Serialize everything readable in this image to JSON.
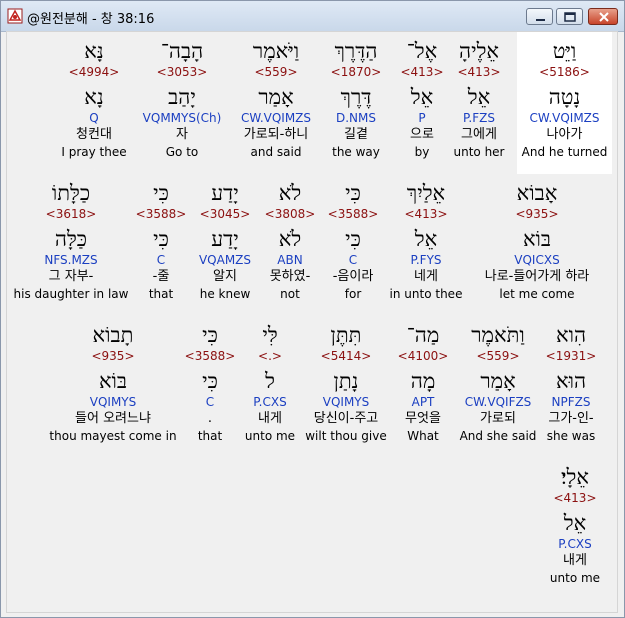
{
  "window": {
    "title": "@원전분해 - 창 38:16"
  },
  "words": [
    {
      "heb": "וַיֵּט",
      "num": "<5186>",
      "lex": "נָטָה",
      "parse": "CW.VQIMZS",
      "kor": "나아가",
      "eng": "And he turned",
      "selected": true
    },
    {
      "heb": "אֵלֶיהָ",
      "num": "<413>",
      "lex": "אֵל",
      "parse": "P.FZS",
      "kor": "그에게",
      "eng": "unto her"
    },
    {
      "heb": "אֶל־",
      "num": "<413>",
      "lex": "אֵל",
      "parse": "P",
      "kor": "으로",
      "eng": "by"
    },
    {
      "heb": "הַדֶּרֶךְ",
      "num": "<1870>",
      "lex": "דֶּרֶךְ",
      "parse": "D.NMS",
      "kor": "길곁",
      "eng": "the way"
    },
    {
      "heb": "וַיֹּאמֶר",
      "num": "<559>",
      "lex": "אָמַר",
      "parse": "CW.VQIMZS",
      "kor": "가로되-하니",
      "eng": "and said"
    },
    {
      "heb": "הָבָה־",
      "num": "<3053>",
      "lex": "יָהַב",
      "parse": "VQMMYS(Ch)",
      "kor": "자",
      "eng": "Go to"
    },
    {
      "heb": "נָּא",
      "num": "<4994>",
      "lex": "נָא",
      "parse": "Q",
      "kor": "청컨대",
      "eng": "I pray thee"
    },
    {
      "heb": "אָבוֹא",
      "num": "<935>",
      "lex": "בּוֹא",
      "parse": "VQICXS",
      "kor": "나로-들어가게 하라",
      "eng": "let me come"
    },
    {
      "heb": "אֵלַיִךְ",
      "num": "<413>",
      "lex": "אֵל",
      "parse": "P.FYS",
      "kor": "네게",
      "eng": "in unto thee"
    },
    {
      "heb": "כִּי",
      "num": "<3588>",
      "lex": "כִּי",
      "parse": "C",
      "kor": "-음이라",
      "eng": "for"
    },
    {
      "heb": "לֹא",
      "num": "<3808>",
      "lex": "לֹא",
      "parse": "ABN",
      "kor": "못하였-",
      "eng": "not"
    },
    {
      "heb": "יָדַע",
      "num": "<3045>",
      "lex": "יָדַע",
      "parse": "VQAMZS",
      "kor": "알지",
      "eng": "he knew"
    },
    {
      "heb": "כִּי",
      "num": "<3588>",
      "lex": "כִּי",
      "parse": "C",
      "kor": "-줄",
      "eng": "that"
    },
    {
      "heb": "כַלָּתוֹ",
      "num": "<3618>",
      "lex": "כַּלָּה",
      "parse": "NFS.MZS",
      "kor": "그 자부-",
      "eng": "his daughter in law"
    },
    {
      "heb": "הִוא",
      "num": "<1931>",
      "lex": "הוּא",
      "parse": "NPFZS",
      "kor": "그가-인-",
      "eng": "she was"
    },
    {
      "heb": "וַתֹּאמֶר",
      "num": "<559>",
      "lex": "אָמַר",
      "parse": "CW.VQIFZS",
      "kor": "가로되",
      "eng": "And she said"
    },
    {
      "heb": "מַה־",
      "num": "<4100>",
      "lex": "מָה",
      "parse": "APT",
      "kor": "무엇을",
      "eng": "What"
    },
    {
      "heb": "תִּתֶּן",
      "num": "<5414>",
      "lex": "נָתַן",
      "parse": "VQIMYS",
      "kor": "당신이-주고",
      "eng": "wilt thou give"
    },
    {
      "heb": "לִּי",
      "num": "<.>",
      "lex": "ל",
      "parse": "P.CXS",
      "kor": "내게",
      "eng": "unto me"
    },
    {
      "heb": "כִּי",
      "num": "<3588>",
      "lex": "כִּי",
      "parse": "C",
      "kor": ".",
      "eng": "that"
    },
    {
      "heb": "תָבוֹא",
      "num": "<935>",
      "lex": "בּוֹא",
      "parse": "VQIMYS",
      "kor": "들어 오려느냐",
      "eng": "thou mayest come in"
    },
    {
      "heb": "אֵלָי׃",
      "num": "<413>",
      "lex": "אֵל",
      "parse": "P.CXS",
      "kor": "내게",
      "eng": "unto me"
    }
  ]
}
